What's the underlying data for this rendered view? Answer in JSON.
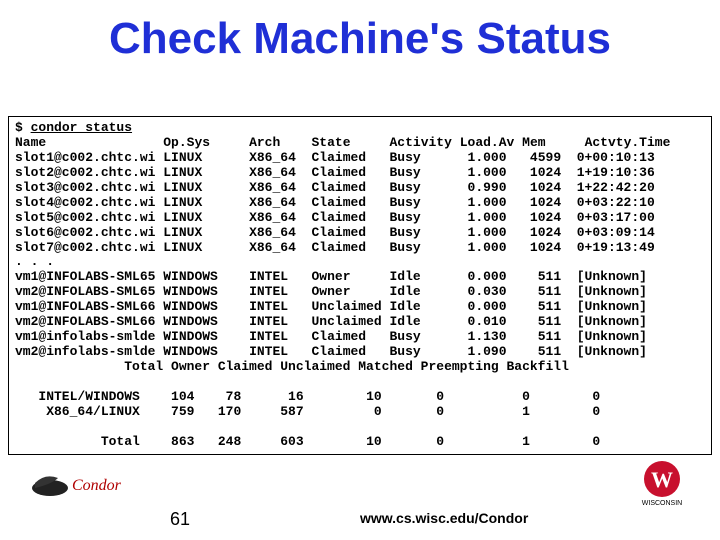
{
  "title": "Check Machine's Status",
  "prompt": "$ ",
  "command": "condor_status",
  "headers": {
    "name": "Name",
    "opsys": "Op.Sys",
    "arch": "Arch",
    "state": "State",
    "activity": "Activity",
    "loadav": "Load.Av",
    "mem": "Mem",
    "actvty": "Actvty.Time"
  },
  "rows_a": [
    {
      "name": "slot1@c002.chtc.wi",
      "opsys": "LINUX",
      "arch": "X86_64",
      "state": "Claimed",
      "activity": "Busy",
      "loadav": "1.000",
      "mem": "4599",
      "actvty": "0+00:10:13"
    },
    {
      "name": "slot2@c002.chtc.wi",
      "opsys": "LINUX",
      "arch": "X86_64",
      "state": "Claimed",
      "activity": "Busy",
      "loadav": "1.000",
      "mem": "1024",
      "actvty": "1+19:10:36"
    },
    {
      "name": "slot3@c002.chtc.wi",
      "opsys": "LINUX",
      "arch": "X86_64",
      "state": "Claimed",
      "activity": "Busy",
      "loadav": "0.990",
      "mem": "1024",
      "actvty": "1+22:42:20"
    },
    {
      "name": "slot4@c002.chtc.wi",
      "opsys": "LINUX",
      "arch": "X86_64",
      "state": "Claimed",
      "activity": "Busy",
      "loadav": "1.000",
      "mem": "1024",
      "actvty": "0+03:22:10"
    },
    {
      "name": "slot5@c002.chtc.wi",
      "opsys": "LINUX",
      "arch": "X86_64",
      "state": "Claimed",
      "activity": "Busy",
      "loadav": "1.000",
      "mem": "1024",
      "actvty": "0+03:17:00"
    },
    {
      "name": "slot6@c002.chtc.wi",
      "opsys": "LINUX",
      "arch": "X86_64",
      "state": "Claimed",
      "activity": "Busy",
      "loadav": "1.000",
      "mem": "1024",
      "actvty": "0+03:09:14"
    },
    {
      "name": "slot7@c002.chtc.wi",
      "opsys": "LINUX",
      "arch": "X86_64",
      "state": "Claimed",
      "activity": "Busy",
      "loadav": "1.000",
      "mem": "1024",
      "actvty": "0+19:13:49"
    }
  ],
  "ellipsis": ". . .",
  "rows_b": [
    {
      "name": "vm1@INFOLABS-SML65",
      "opsys": "WINDOWS",
      "arch": "INTEL",
      "state": "Owner",
      "activity": "Idle",
      "loadav": "0.000",
      "mem": "511",
      "actvty": "[Unknown]"
    },
    {
      "name": "vm2@INFOLABS-SML65",
      "opsys": "WINDOWS",
      "arch": "INTEL",
      "state": "Owner",
      "activity": "Idle",
      "loadav": "0.030",
      "mem": "511",
      "actvty": "[Unknown]"
    },
    {
      "name": "vm1@INFOLABS-SML66",
      "opsys": "WINDOWS",
      "arch": "INTEL",
      "state": "Unclaimed",
      "activity": "Idle",
      "loadav": "0.000",
      "mem": "511",
      "actvty": "[Unknown]"
    },
    {
      "name": "vm2@INFOLABS-SML66",
      "opsys": "WINDOWS",
      "arch": "INTEL",
      "state": "Unclaimed",
      "activity": "Idle",
      "loadav": "0.010",
      "mem": "511",
      "actvty": "[Unknown]"
    },
    {
      "name": "vm1@infolabs-smlde",
      "opsys": "WINDOWS",
      "arch": "INTEL",
      "state": "Claimed",
      "activity": "Busy",
      "loadav": "1.130",
      "mem": "511",
      "actvty": "[Unknown]"
    },
    {
      "name": "vm2@infolabs-smlde",
      "opsys": "WINDOWS",
      "arch": "INTEL",
      "state": "Claimed",
      "activity": "Busy",
      "loadav": "1.090",
      "mem": "511",
      "actvty": "[Unknown]"
    }
  ],
  "summary_header": "              Total Owner Claimed Unclaimed Matched Preempting Backfill",
  "summary_rows": [
    {
      "label": "INTEL/WINDOWS",
      "total": "104",
      "owner": "78",
      "claimed": "16",
      "unclaimed": "10",
      "matched": "0",
      "preempting": "0",
      "backfill": "0"
    },
    {
      "label": "X86_64/LINUX",
      "total": "759",
      "owner": "170",
      "claimed": "587",
      "unclaimed": "0",
      "matched": "0",
      "preempting": "1",
      "backfill": "0"
    }
  ],
  "summary_total": {
    "label": "Total",
    "total": "863",
    "owner": "248",
    "claimed": "603",
    "unclaimed": "10",
    "matched": "0",
    "preempting": "1",
    "backfill": "0"
  },
  "footer": {
    "page": "61",
    "url": "www.cs.wisc.edu/Condor",
    "wisc": "WISCONSIN"
  }
}
